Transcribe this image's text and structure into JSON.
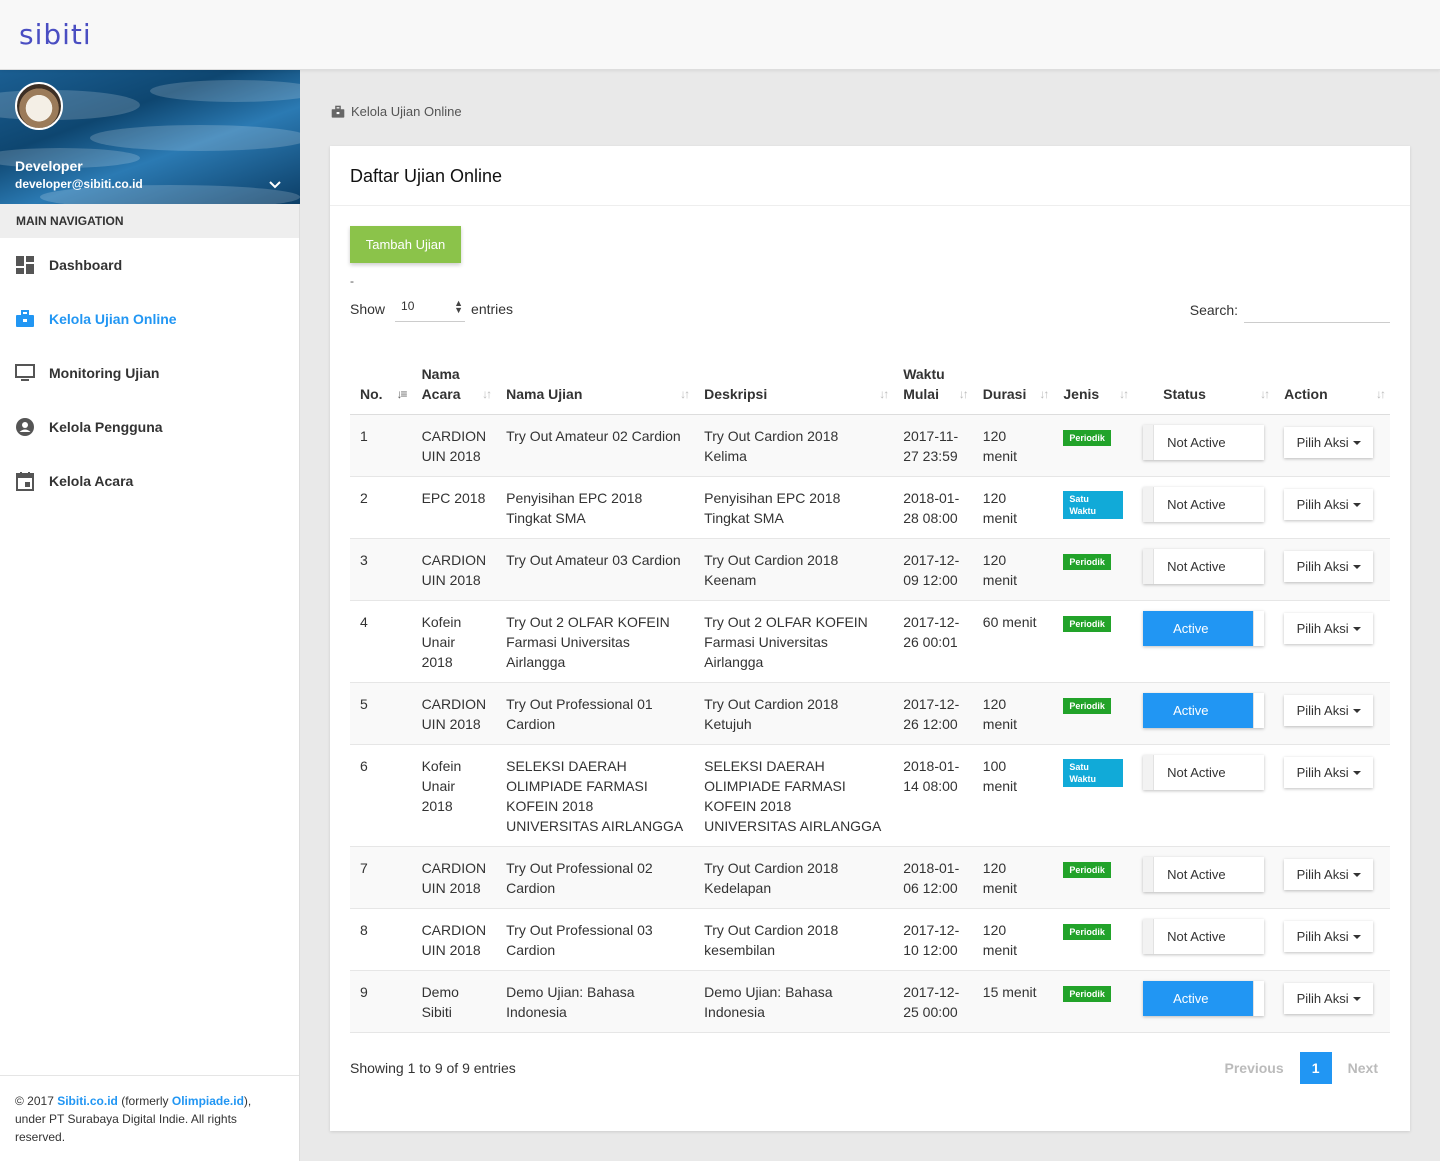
{
  "app": {
    "logo": "sibiti"
  },
  "user": {
    "name": "Developer",
    "email": "developer@sibiti.co.id"
  },
  "sidebar": {
    "header": "MAIN NAVIGATION",
    "items": [
      {
        "label": "Dashboard",
        "icon": "dashboard-icon"
      },
      {
        "label": "Kelola Ujian Online",
        "icon": "briefcase-icon"
      },
      {
        "label": "Monitoring Ujian",
        "icon": "monitor-icon"
      },
      {
        "label": "Kelola Pengguna",
        "icon": "account-circle-icon"
      },
      {
        "label": "Kelola Acara",
        "icon": "calendar-icon"
      }
    ],
    "footer": {
      "prefix": "© 2017 ",
      "link1": "Sibiti.co.id",
      "mid": " (formerly ",
      "link2": "Olimpiade.id",
      "suffix": "), under PT Surabaya Digital Indie. All rights reserved."
    }
  },
  "breadcrumb": "Kelola Ujian Online",
  "card": {
    "title": "Daftar Ujian Online",
    "add_button": "Tambah Ujian",
    "dash": "-",
    "show_label": "Show",
    "length_value": "10",
    "entries_label": "entries",
    "search_label": "Search:",
    "search_value": ""
  },
  "table": {
    "headers": [
      "No.",
      "Nama Acara",
      "Nama Ujian",
      "Deskripsi",
      "Waktu Mulai",
      "Durasi",
      "Jenis",
      "Status",
      "Action"
    ],
    "rows": [
      {
        "no": "1",
        "acara": "CARDION UIN 2018",
        "ujian": "Try Out Amateur 02 Cardion",
        "deskripsi": "Try Out Cardion 2018 Kelima",
        "waktu": "2017-11-27 23:59",
        "durasi": "120 menit",
        "jenis": "Periodik",
        "status": "Not Active",
        "action": "Pilih Aksi"
      },
      {
        "no": "2",
        "acara": "EPC 2018",
        "ujian": "Penyisihan EPC 2018 Tingkat SMA",
        "deskripsi": "Penyisihan EPC 2018 Tingkat SMA",
        "waktu": "2018-01-28 08:00",
        "durasi": "120 menit",
        "jenis": "Satu Waktu",
        "status": "Not Active",
        "action": "Pilih Aksi"
      },
      {
        "no": "3",
        "acara": "CARDION UIN 2018",
        "ujian": "Try Out Amateur 03 Cardion",
        "deskripsi": "Try Out Cardion 2018 Keenam",
        "waktu": "2017-12-09 12:00",
        "durasi": "120 menit",
        "jenis": "Periodik",
        "status": "Not Active",
        "action": "Pilih Aksi"
      },
      {
        "no": "4",
        "acara": "Kofein Unair 2018",
        "ujian": "Try Out 2 OLFAR KOFEIN Farmasi Universitas Airlangga",
        "deskripsi": "Try Out 2 OLFAR KOFEIN Farmasi Universitas Airlangga",
        "waktu": "2017-12-26 00:01",
        "durasi": "60 menit",
        "jenis": "Periodik",
        "status": "Active",
        "action": "Pilih Aksi"
      },
      {
        "no": "5",
        "acara": "CARDION UIN 2018",
        "ujian": "Try Out Professional 01 Cardion",
        "deskripsi": "Try Out Cardion 2018 Ketujuh",
        "waktu": "2017-12-26 12:00",
        "durasi": "120 menit",
        "jenis": "Periodik",
        "status": "Active",
        "action": "Pilih Aksi"
      },
      {
        "no": "6",
        "acara": "Kofein Unair 2018",
        "ujian": "SELEKSI DAERAH OLIMPIADE FARMASI KOFEIN 2018 UNIVERSITAS AIRLANGGA",
        "deskripsi": "SELEKSI DAERAH OLIMPIADE FARMASI KOFEIN 2018 UNIVERSITAS AIRLANGGA",
        "waktu": "2018-01-14 08:00",
        "durasi": "100 menit",
        "jenis": "Satu Waktu",
        "status": "Not Active",
        "action": "Pilih Aksi"
      },
      {
        "no": "7",
        "acara": "CARDION UIN 2018",
        "ujian": "Try Out Professional 02 Cardion",
        "deskripsi": "Try Out Cardion 2018 Kedelapan",
        "waktu": "2018-01-06 12:00",
        "durasi": "120 menit",
        "jenis": "Periodik",
        "status": "Not Active",
        "action": "Pilih Aksi"
      },
      {
        "no": "8",
        "acara": "CARDION UIN 2018",
        "ujian": "Try Out Professional 03 Cardion",
        "deskripsi": "Try Out Cardion 2018 kesembilan",
        "waktu": "2017-12-10 12:00",
        "durasi": "120 menit",
        "jenis": "Periodik",
        "status": "Not Active",
        "action": "Pilih Aksi"
      },
      {
        "no": "9",
        "acara": "Demo Sibiti",
        "ujian": "Demo Ujian: Bahasa Indonesia",
        "deskripsi": "Demo Ujian: Bahasa Indonesia",
        "waktu": "2017-12-25 00:00",
        "durasi": "15 menit",
        "jenis": "Periodik",
        "status": "Active",
        "action": "Pilih Aksi"
      }
    ]
  },
  "footer_info": "Showing 1 to 9 of 9 entries",
  "pagination": {
    "previous": "Previous",
    "current": "1",
    "next": "Next"
  },
  "colors": {
    "accent": "#2196f3",
    "add_button": "#8bc34a",
    "badge_periodik": "#22a32a",
    "badge_satu_waktu": "#11aad8"
  }
}
